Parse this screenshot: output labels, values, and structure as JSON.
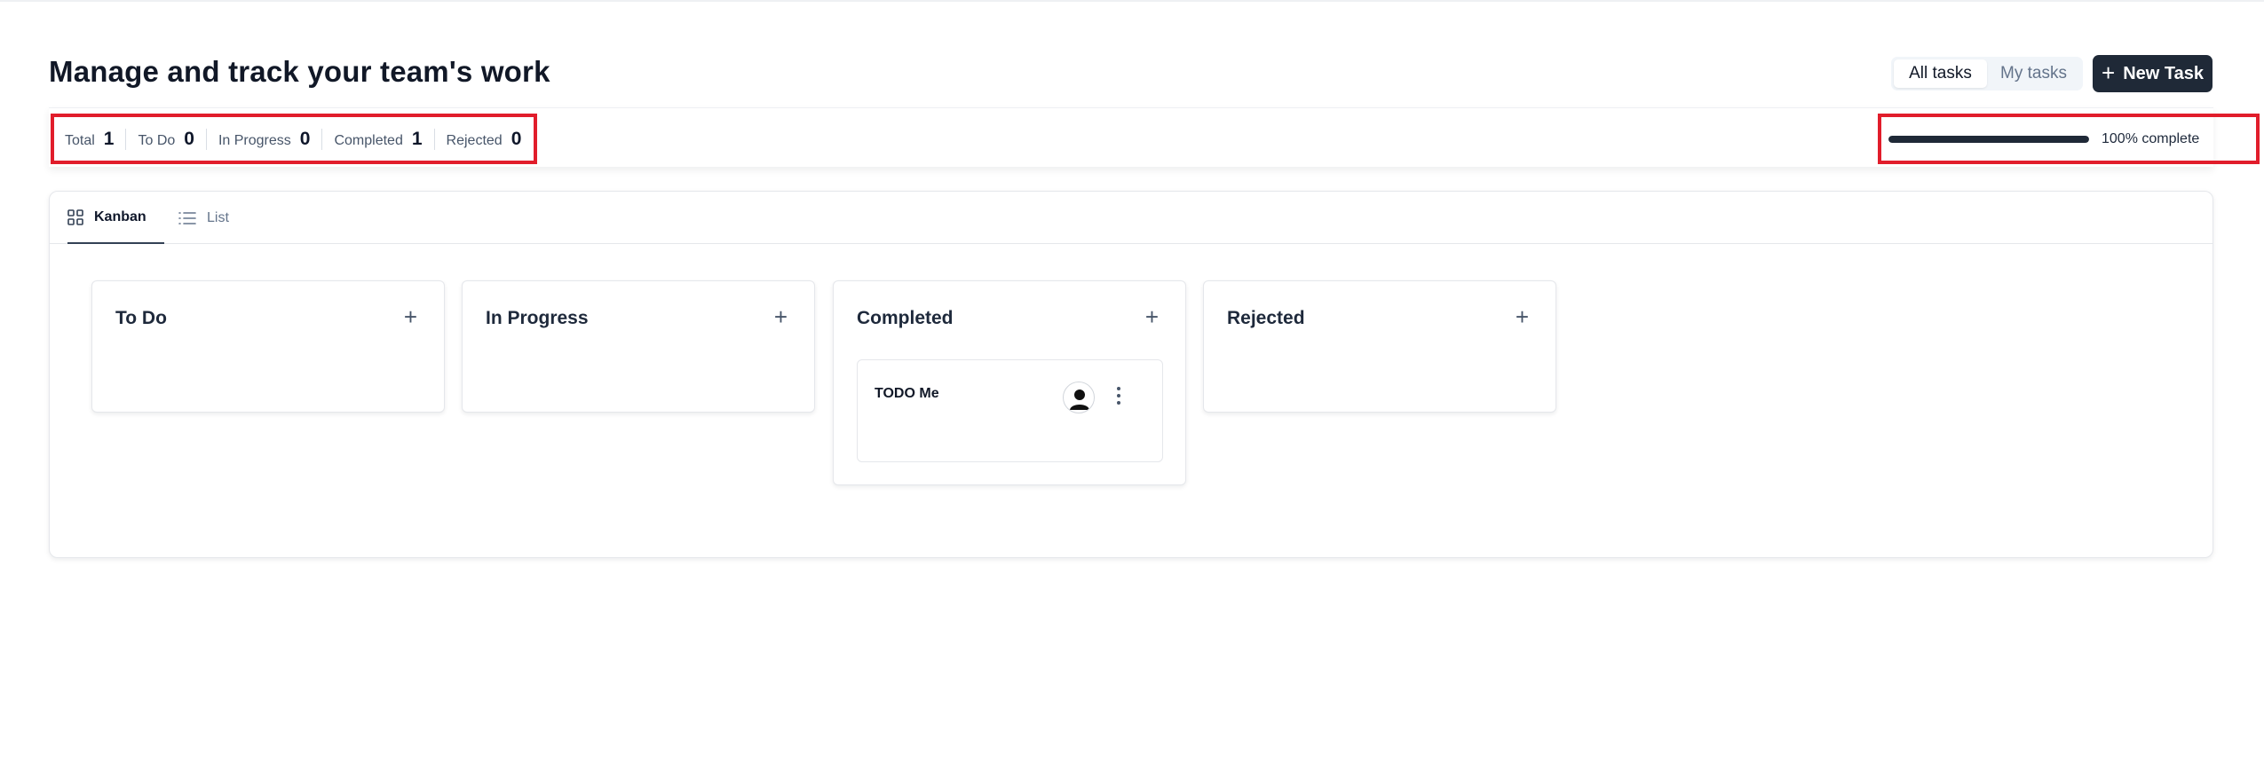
{
  "header": {
    "title": "Manage and track your team's work",
    "filter": {
      "options": [
        "All tasks",
        "My tasks"
      ],
      "selected": "All tasks"
    },
    "new_task_label": "New Task"
  },
  "stats": {
    "items": [
      {
        "label": "Total",
        "value": "1"
      },
      {
        "label": "To Do",
        "value": "0"
      },
      {
        "label": "In Progress",
        "value": "0"
      },
      {
        "label": "Completed",
        "value": "1"
      },
      {
        "label": "Rejected",
        "value": "0"
      }
    ],
    "progress": {
      "percent": 100,
      "label": "100% complete"
    }
  },
  "view_tabs": [
    {
      "label": "Kanban",
      "icon": "grid-icon",
      "active": true
    },
    {
      "label": "List",
      "icon": "list-icon",
      "active": false
    }
  ],
  "columns": [
    {
      "title": "To Do",
      "cards": []
    },
    {
      "title": "In Progress",
      "cards": []
    },
    {
      "title": "Completed",
      "cards": [
        {
          "title": "TODO Me",
          "assignee_icon": "user-avatar-icon",
          "menu_icon": "more-vertical-icon"
        }
      ]
    },
    {
      "title": "Rejected",
      "cards": []
    }
  ],
  "colors": {
    "primary_button": "#1f2937",
    "highlight_border": "#e11d2b",
    "progress_fill": "#1f2937",
    "text_dark": "#111827",
    "text_muted": "#64748b"
  }
}
